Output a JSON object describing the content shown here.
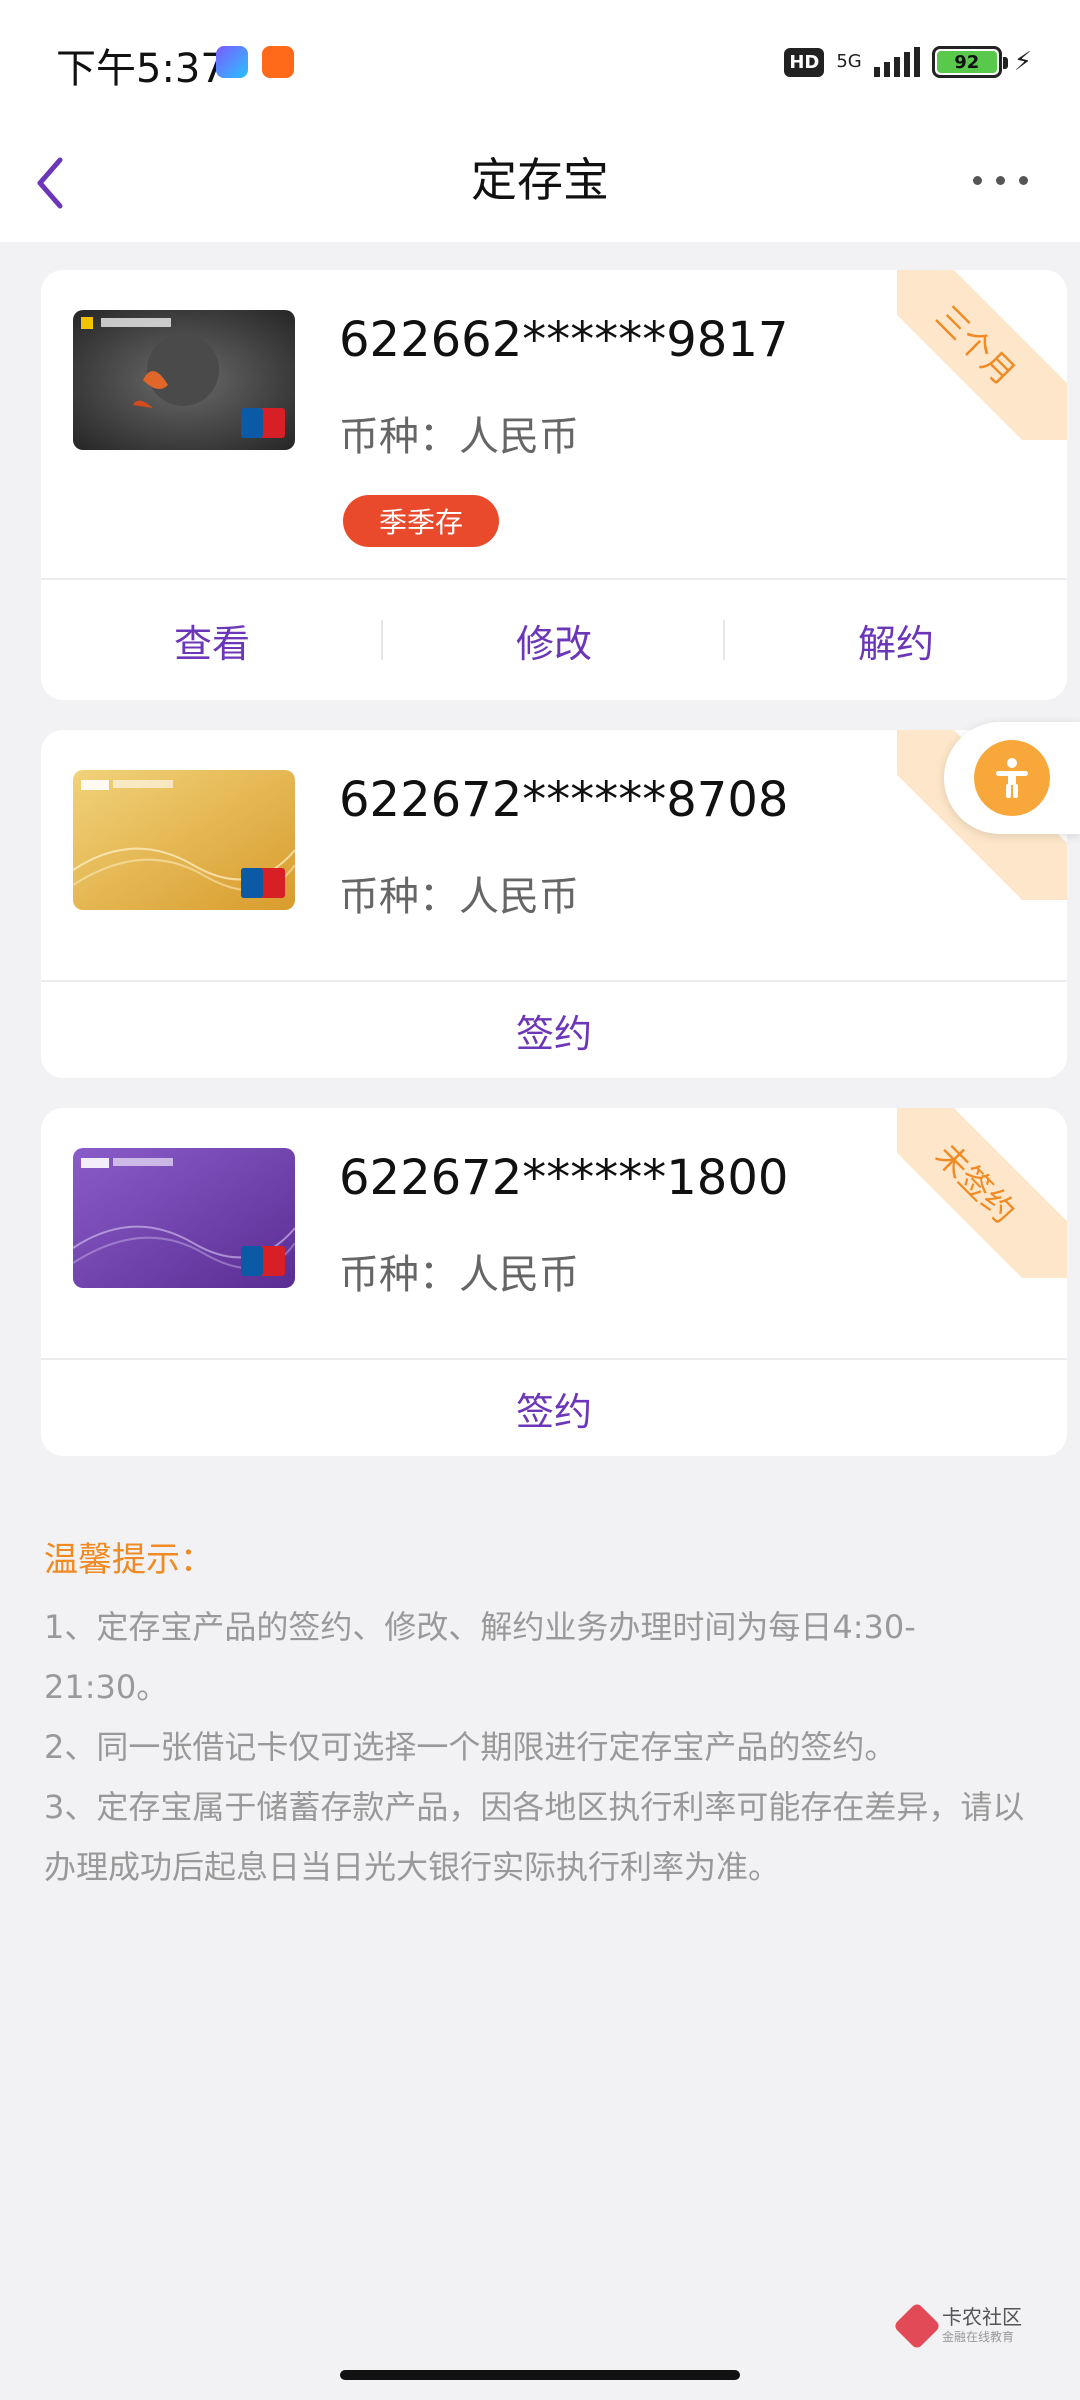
{
  "status_bar": {
    "time": "下午5:37",
    "hd": "HD",
    "network": "5G",
    "battery": "92"
  },
  "nav": {
    "title": "定存宝"
  },
  "cards": [
    {
      "number": "622662******9817",
      "currency": "币种：人民币",
      "tag": "季季存",
      "ribbon": "三个月",
      "actions": [
        "查看",
        "修改",
        "解约"
      ]
    },
    {
      "number": "622672******8708",
      "currency": "币种：人民币",
      "actions": [
        "签约"
      ]
    },
    {
      "number": "622672******1800",
      "currency": "币种：人民币",
      "ribbon": "未签约",
      "actions": [
        "签约"
      ]
    }
  ],
  "tips": {
    "title": "温馨提示：",
    "items": [
      "1、定存宝产品的签约、修改、解约业务办理时间为每日4:30-21:30。",
      "2、同一张借记卡仅可选择一个期限进行定存宝产品的签约。",
      "3、定存宝属于储蓄存款产品，因各地区执行利率可能存在差异，请以办理成功后起息日当日光大银行实际执行利率为准。"
    ]
  },
  "watermark": {
    "name": "卡农社区",
    "sub": "金融在线教育"
  },
  "colors": {
    "accent": "#6b36b8",
    "tag": "#e94a2c",
    "ribbon_bg": "#fde6c9",
    "ribbon_text": "#f08a23",
    "tips_title": "#f08a23"
  }
}
